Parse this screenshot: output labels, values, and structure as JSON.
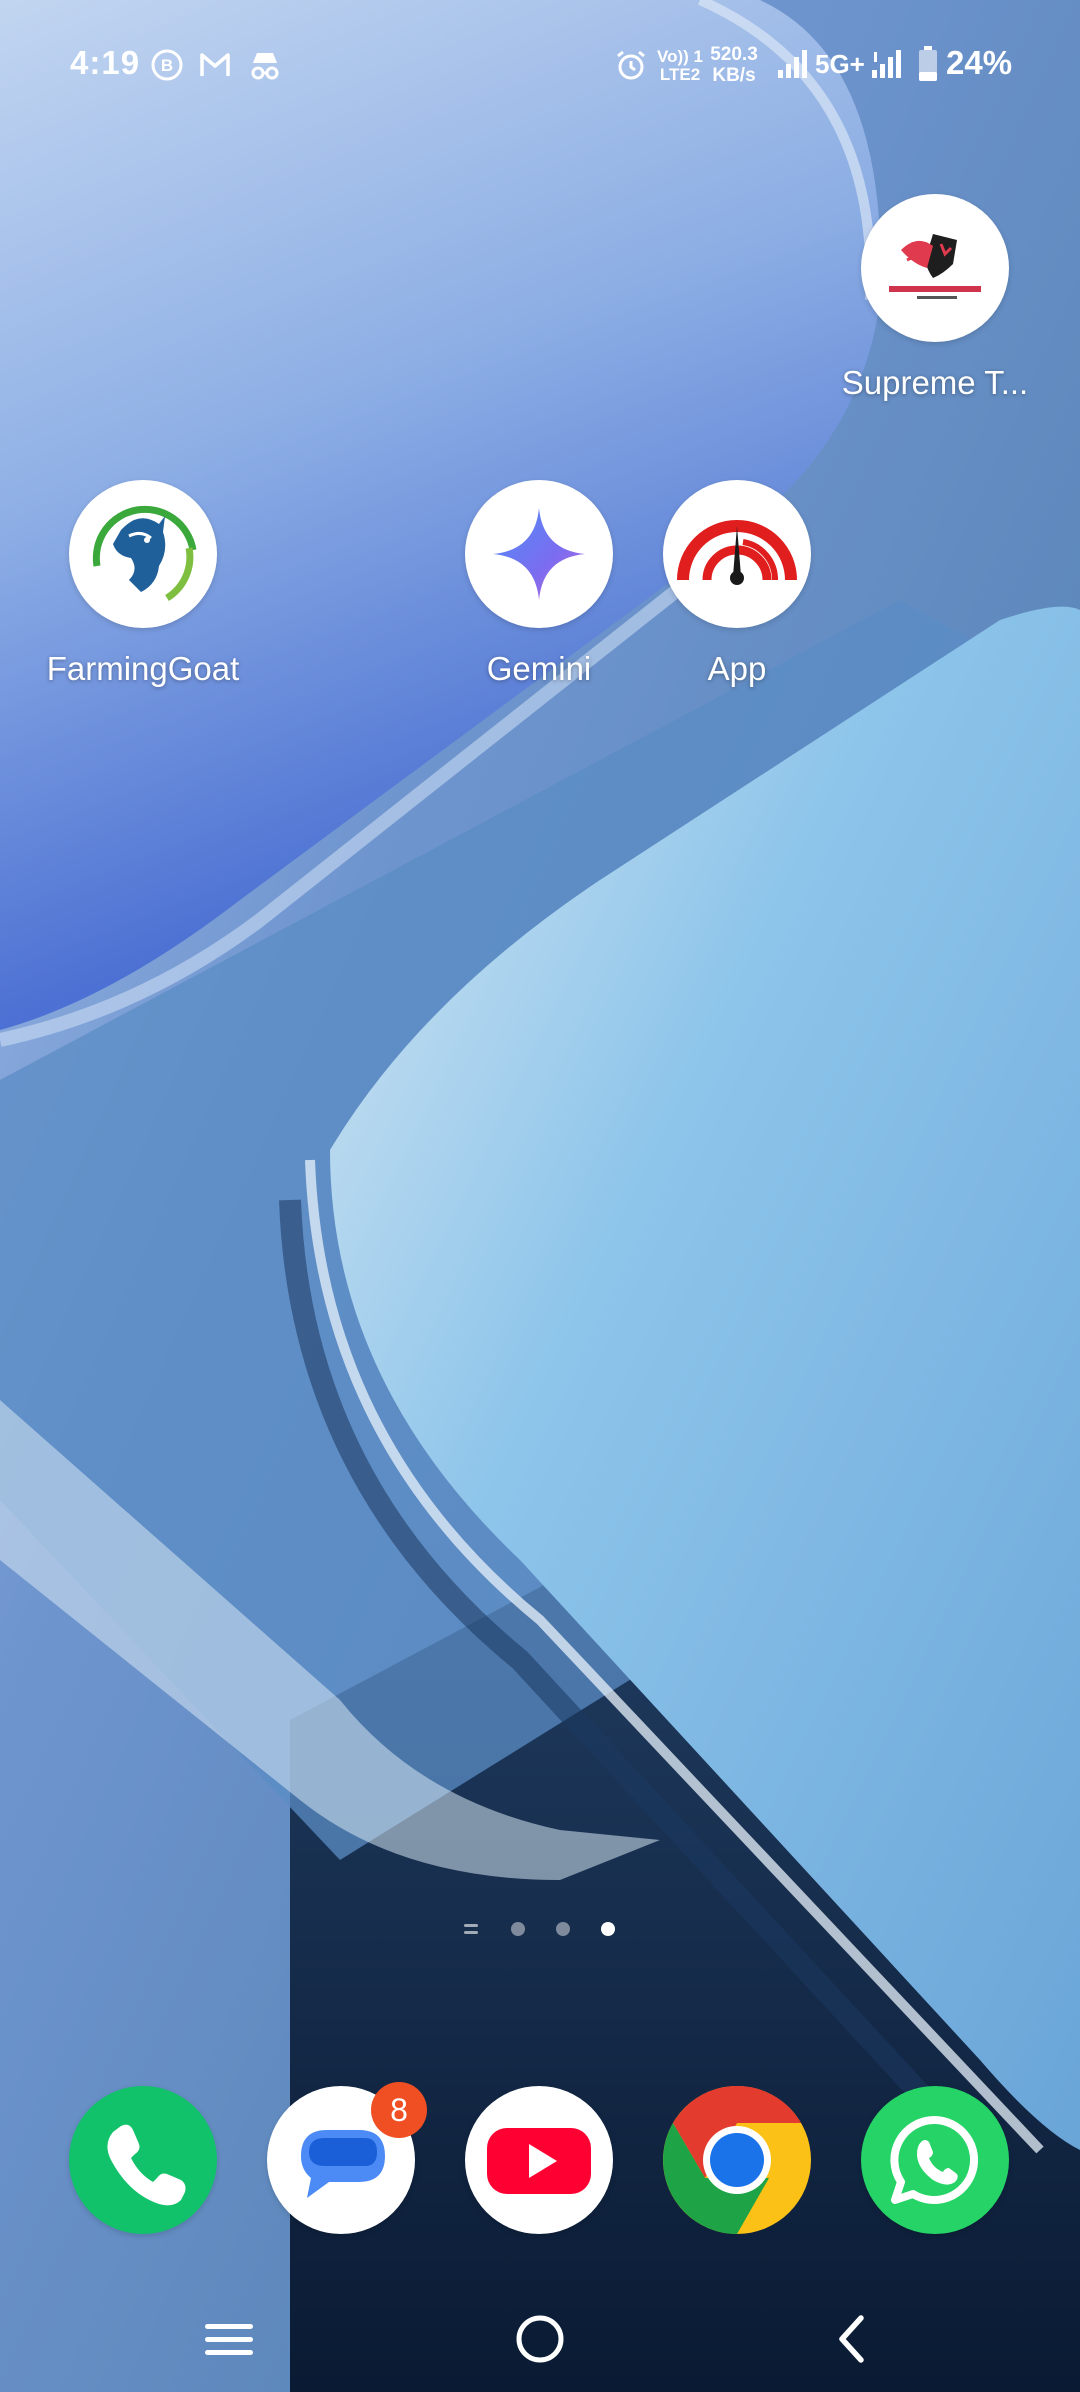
{
  "status_bar": {
    "time": "4:19",
    "volte_line1": "Vo)) 1",
    "volte_line2": "LTE2",
    "speed_value": "520.3",
    "speed_unit": "KB/s",
    "network": "5G+",
    "battery": "24%"
  },
  "apps": {
    "supreme": {
      "label": "Supreme T..."
    },
    "farminggoat": {
      "label": "FarmingGoat"
    },
    "gemini": {
      "label": "Gemini"
    },
    "app": {
      "label": "App"
    }
  },
  "page_indicator": {
    "current": 4,
    "total": 4
  },
  "dock": {
    "phone": {
      "icon": "phone-icon"
    },
    "messages": {
      "icon": "messages-icon",
      "badge": "8"
    },
    "youtube": {
      "icon": "youtube-icon"
    },
    "chrome": {
      "icon": "chrome-icon"
    },
    "whatsapp": {
      "icon": "whatsapp-icon"
    }
  },
  "colors": {
    "badge": "#f04e23",
    "phone_green": "#12c26a",
    "whatsapp_green": "#25d366",
    "youtube_red": "#ff0033"
  }
}
